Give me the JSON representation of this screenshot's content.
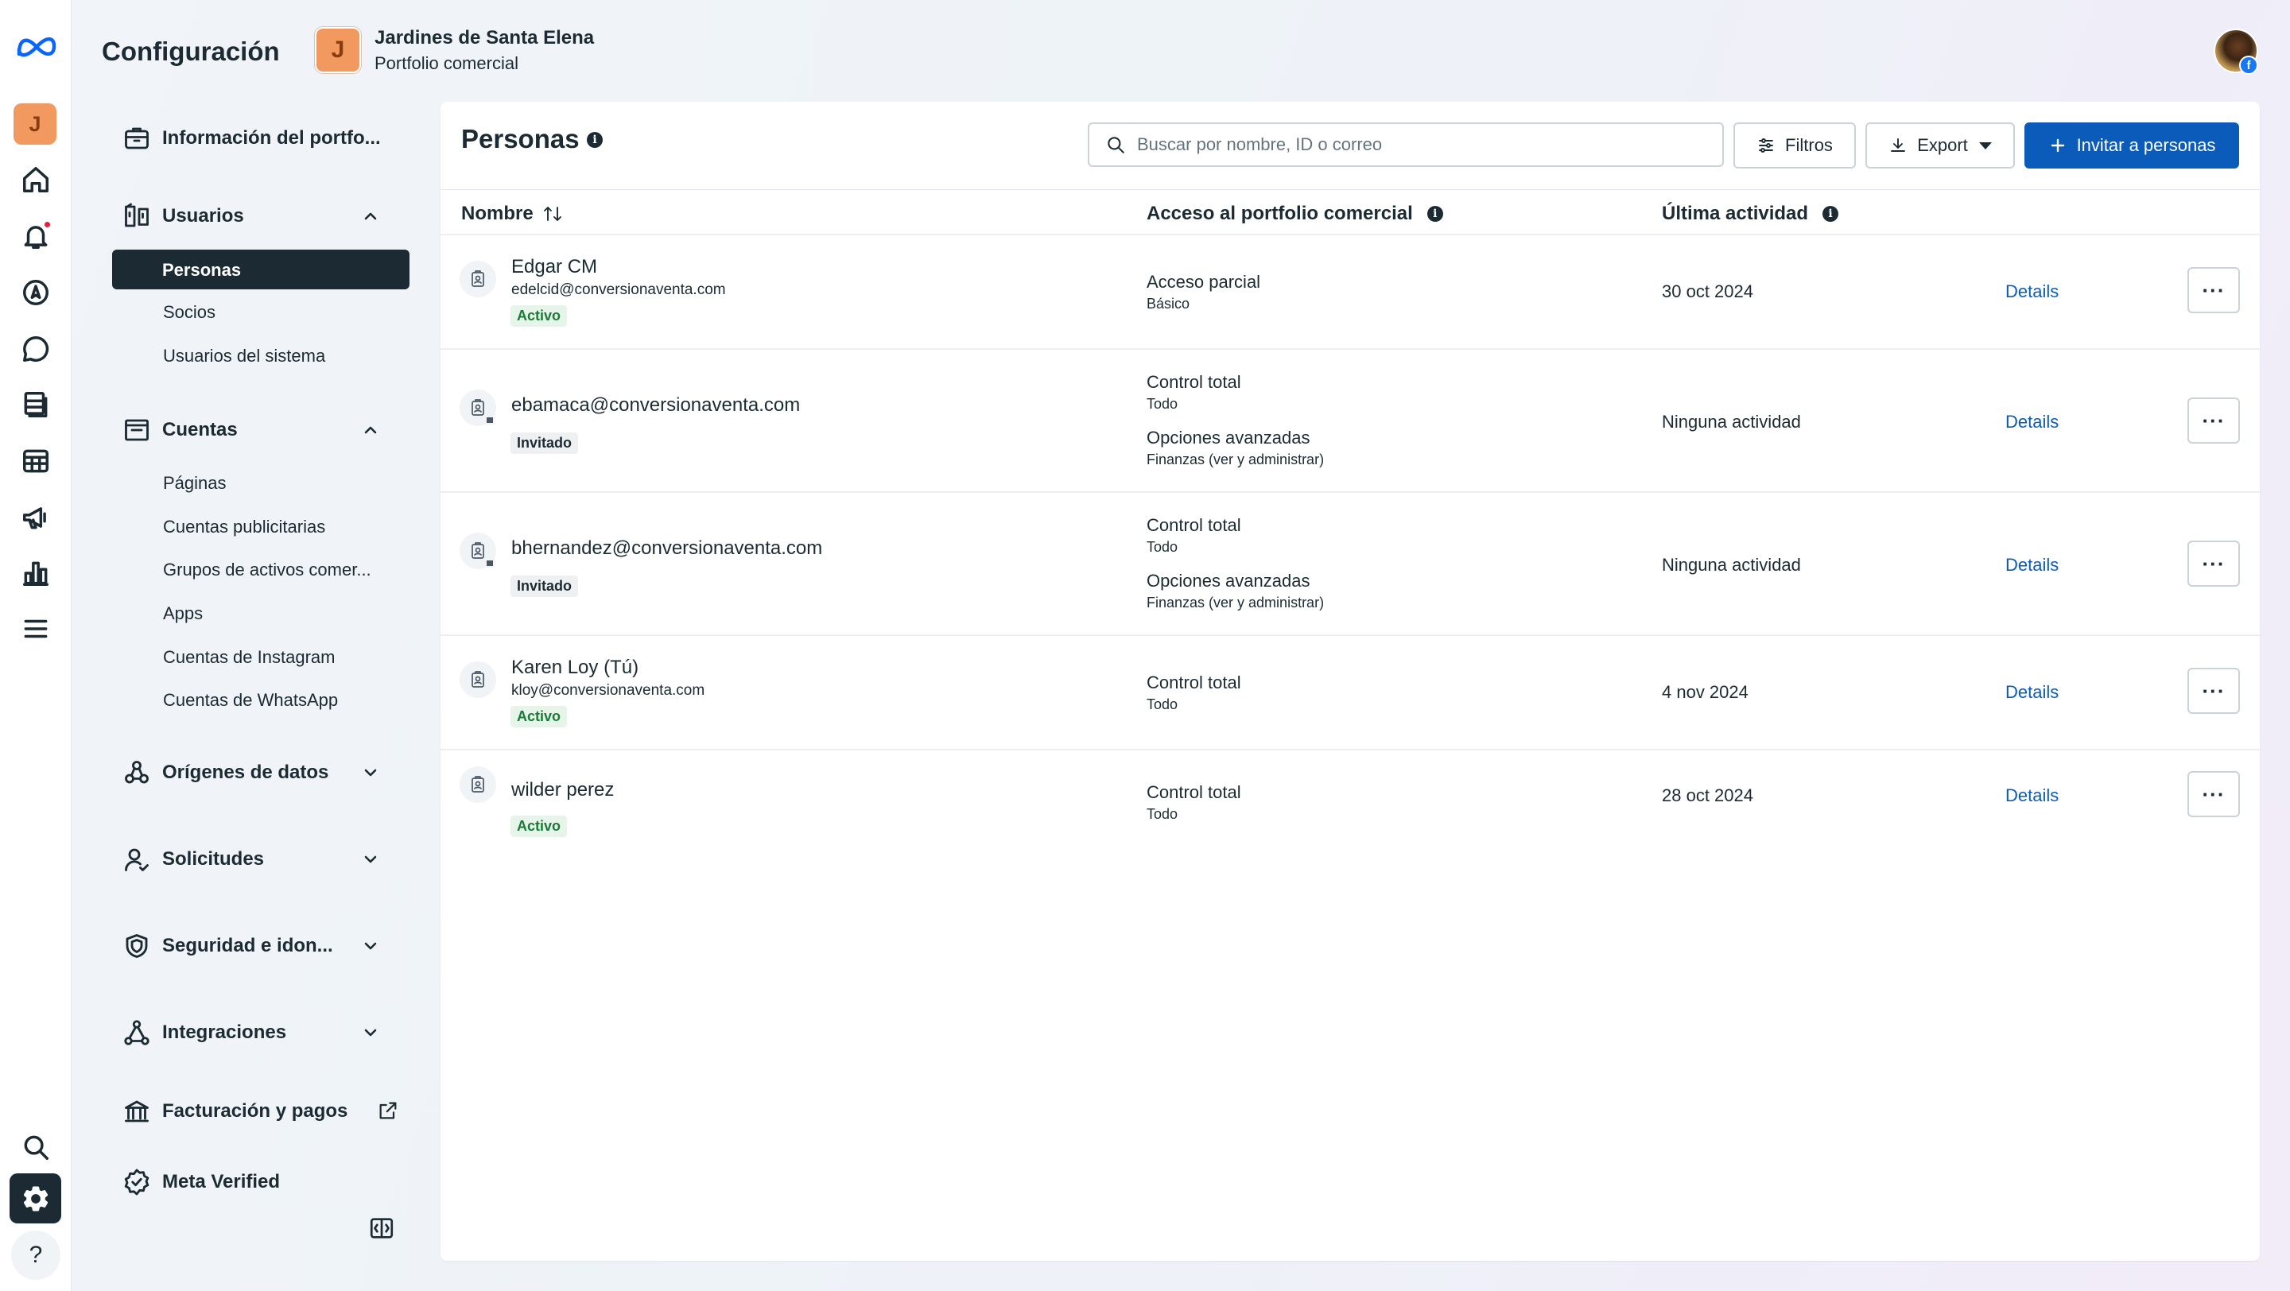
{
  "header": {
    "title": "Configuración",
    "business_initial": "J",
    "business_name": "Jardines de Santa Elena",
    "business_type": "Portfolio comercial"
  },
  "rail": {
    "avatar_initial": "J",
    "icons": [
      "meta-logo",
      "home-icon",
      "bell-icon",
      "compass-icon",
      "chat-icon",
      "content-icon",
      "table-icon",
      "megaphone-icon",
      "bar-chart-icon",
      "menu-icon",
      "search-icon",
      "gear-icon",
      "help-icon"
    ],
    "help": "?"
  },
  "sidebar": {
    "business_info": "Información del portfo...",
    "users": {
      "label": "Usuarios",
      "items": [
        "Personas",
        "Socios",
        "Usuarios del sistema"
      ]
    },
    "accounts": {
      "label": "Cuentas",
      "items": [
        "Páginas",
        "Cuentas publicitarias",
        "Grupos de activos comer...",
        "Apps",
        "Cuentas de Instagram",
        "Cuentas de WhatsApp"
      ]
    },
    "data_sources": "Orígenes de datos",
    "requests": "Solicitudes",
    "security": "Seguridad e idon...",
    "integrations": "Integraciones",
    "billing": "Facturación y pagos",
    "verified": "Meta Verified"
  },
  "main": {
    "title": "Personas",
    "search_placeholder": "Buscar por nombre, ID o correo",
    "filters": "Filtros",
    "export": "Export",
    "invite": "Invitar a personas",
    "columns": {
      "name": "Nombre",
      "access": "Acceso al portfolio comercial",
      "activity": "Última actividad"
    },
    "rows": [
      {
        "name": "Edgar CM",
        "email": "edelcid@conversionaventa.com",
        "status": "Activo",
        "access": [
          {
            "main": "Acceso parcial",
            "sub": "Básico"
          }
        ],
        "activity": "30 oct 2024",
        "details": "Details"
      },
      {
        "name": "ebamaca@conversionaventa.com",
        "email": "",
        "status": "Invitado",
        "access": [
          {
            "main": "Control total",
            "sub": "Todo"
          },
          {
            "main": "Opciones avanzadas",
            "sub": "Finanzas (ver y administrar)"
          }
        ],
        "activity": "Ninguna actividad",
        "details": "Details"
      },
      {
        "name": "bhernandez@conversionaventa.com",
        "email": "",
        "status": "Invitado",
        "access": [
          {
            "main": "Control total",
            "sub": "Todo"
          },
          {
            "main": "Opciones avanzadas",
            "sub": "Finanzas (ver y administrar)"
          }
        ],
        "activity": "Ninguna actividad",
        "details": "Details"
      },
      {
        "name": "Karen Loy (Tú)",
        "email": "kloy@conversionaventa.com",
        "status": "Activo",
        "access": [
          {
            "main": "Control total",
            "sub": "Todo"
          }
        ],
        "activity": "4 nov 2024",
        "details": "Details"
      },
      {
        "name": "wilder perez",
        "email": "",
        "status": "Activo",
        "access": [
          {
            "main": "Control total",
            "sub": "Todo"
          }
        ],
        "activity": "28 oct 2024",
        "details": "Details"
      }
    ]
  },
  "colors": {
    "accent": "#0a5bba",
    "dark": "#1c2b33",
    "active_badge": "#1b7a38",
    "notification": "#e41e3f",
    "avatar": "#f2995f"
  }
}
